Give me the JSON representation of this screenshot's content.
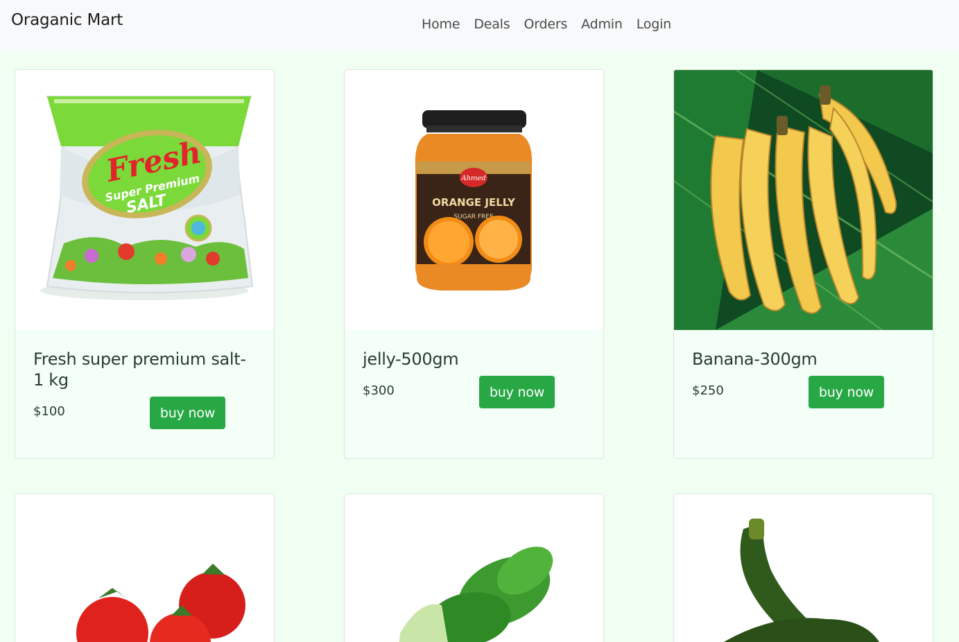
{
  "navbar": {
    "brand": "Oraganic Mart",
    "links": [
      "Home",
      "Deals",
      "Orders",
      "Admin",
      "Login"
    ]
  },
  "products": [
    {
      "title": "Fresh super premium salt-1 kg",
      "price": "$100",
      "button": "buy now",
      "image": "salt-packet-image"
    },
    {
      "title": "jelly-500gm",
      "price": "$300",
      "button": "buy now",
      "image": "orange-jelly-jar-image"
    },
    {
      "title": "Banana-300gm",
      "price": "$250",
      "button": "buy now",
      "image": "banana-bunch-image"
    },
    {
      "image": "tomatoes-image"
    },
    {
      "image": "spinach-image"
    },
    {
      "image": "zucchini-image"
    }
  ],
  "salt_pack": {
    "brand": "Fresh",
    "line1": "Super Premium",
    "line2": "SALT"
  },
  "jelly_label": {
    "brand": "Ahmed",
    "name": "ORANGE JELLY",
    "sub": "SUGAR FREE"
  },
  "colors": {
    "accent": "#28a745",
    "page_bg": "#f0fff2",
    "card_bg": "#f3fff7",
    "navbar_bg": "#f8f9fa"
  }
}
